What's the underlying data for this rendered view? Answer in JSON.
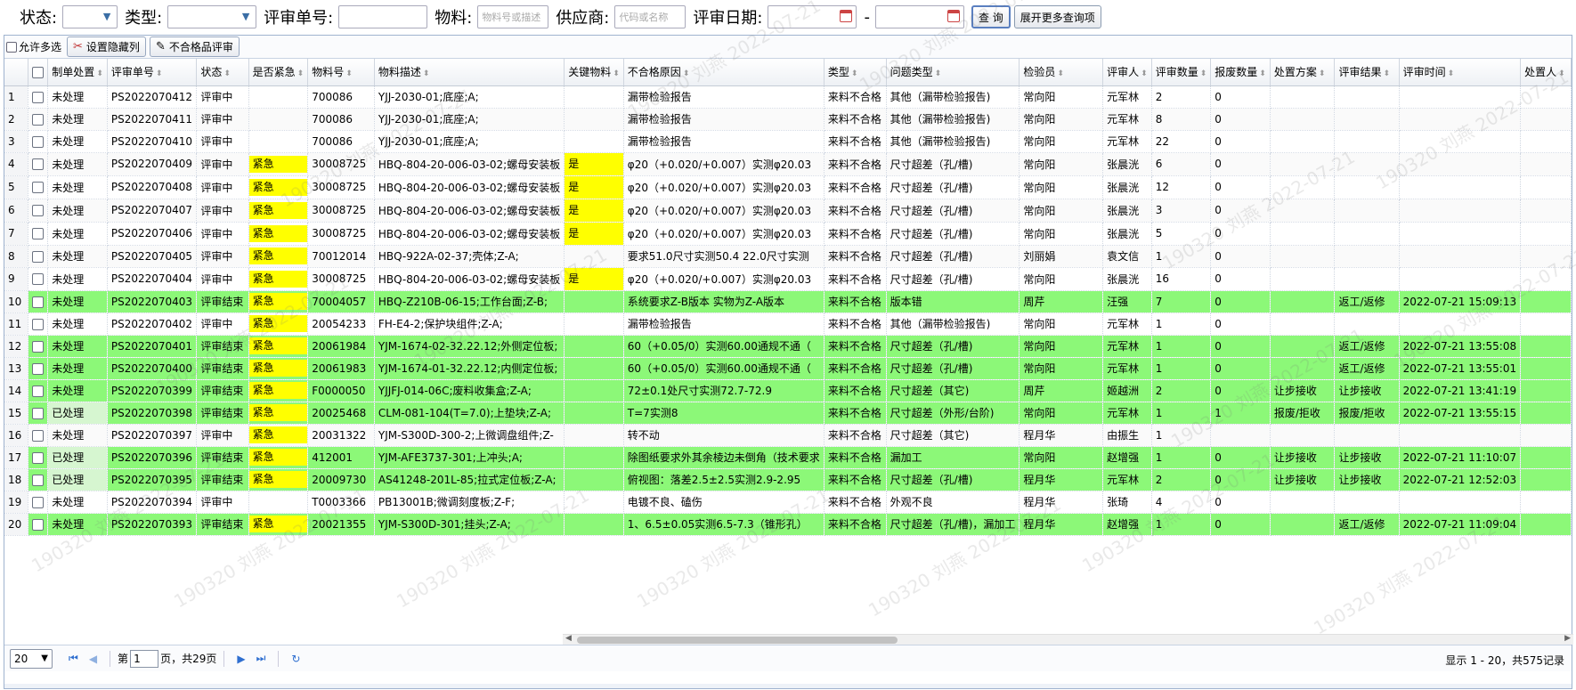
{
  "query": {
    "status_label": "状态:",
    "type_label": "类型:",
    "review_no_label": "评审单号:",
    "material_label": "物料:",
    "material_placeholder": "物料号或描述",
    "supplier_label": "供应商:",
    "supplier_placeholder": "代码或名称",
    "review_date_label": "评审日期:",
    "date_sep": "-",
    "query_btn": "查 询",
    "more_btn": "展开更多查询项"
  },
  "toolbar": {
    "multi_select": "允许多选",
    "hide_cols": "设置隐藏列",
    "nonconform_review": "不合格品评审"
  },
  "columns": [
    "制单处置",
    "评审单号",
    "状态",
    "是否紧急",
    "物料号",
    "物料描述",
    "关键物料",
    "不合格原因",
    "类型",
    "问题类型",
    "检验员",
    "评审人",
    "评审数量",
    "报废数量",
    "处置方案",
    "评审结果",
    "评审时间",
    "处置人"
  ],
  "rows": [
    {
      "n": "1",
      "c": [
        "未处理",
        "PS2022070412",
        "评审中",
        "",
        "700086",
        "YJJ-2030-01;底座;A;",
        "",
        "漏带检验报告",
        "来料不合格",
        "其他（漏带检验报告)",
        "常向阳",
        "元军林",
        "2",
        "0",
        "",
        "",
        ""
      ],
      "green": false
    },
    {
      "n": "2",
      "c": [
        "未处理",
        "PS2022070411",
        "评审中",
        "",
        "700086",
        "YJJ-2030-01;底座;A;",
        "",
        "漏带检验报告",
        "来料不合格",
        "其他（漏带检验报告)",
        "常向阳",
        "元军林",
        "8",
        "0",
        "",
        "",
        ""
      ],
      "green": false
    },
    {
      "n": "3",
      "c": [
        "未处理",
        "PS2022070410",
        "评审中",
        "",
        "700086",
        "YJJ-2030-01;底座;A;",
        "",
        "漏带检验报告",
        "来料不合格",
        "其他（漏带检验报告)",
        "常向阳",
        "元军林",
        "22",
        "0",
        "",
        "",
        ""
      ],
      "green": false
    },
    {
      "n": "4",
      "c": [
        "未处理",
        "PS2022070409",
        "评审中",
        "紧急",
        "30008725",
        "HBQ-804-20-006-03-02;螺母安装板",
        "是",
        "φ20（+0.020/+0.007）实测φ20.03",
        "来料不合格",
        "尺寸超差（孔/槽)",
        "常向阳",
        "张晨洸",
        "6",
        "0",
        "",
        "",
        ""
      ],
      "green": false
    },
    {
      "n": "5",
      "c": [
        "未处理",
        "PS2022070408",
        "评审中",
        "紧急",
        "30008725",
        "HBQ-804-20-006-03-02;螺母安装板",
        "是",
        "φ20（+0.020/+0.007）实测φ20.03",
        "来料不合格",
        "尺寸超差（孔/槽)",
        "常向阳",
        "张晨洸",
        "12",
        "0",
        "",
        "",
        ""
      ],
      "green": false
    },
    {
      "n": "6",
      "c": [
        "未处理",
        "PS2022070407",
        "评审中",
        "紧急",
        "30008725",
        "HBQ-804-20-006-03-02;螺母安装板",
        "是",
        "φ20（+0.020/+0.007）实测φ20.03",
        "来料不合格",
        "尺寸超差（孔/槽)",
        "常向阳",
        "张晨洸",
        "3",
        "0",
        "",
        "",
        ""
      ],
      "green": false
    },
    {
      "n": "7",
      "c": [
        "未处理",
        "PS2022070406",
        "评审中",
        "紧急",
        "30008725",
        "HBQ-804-20-006-03-02;螺母安装板",
        "是",
        "φ20（+0.020/+0.007）实测φ20.03",
        "来料不合格",
        "尺寸超差（孔/槽)",
        "常向阳",
        "张晨洸",
        "5",
        "0",
        "",
        "",
        ""
      ],
      "green": false
    },
    {
      "n": "8",
      "c": [
        "未处理",
        "PS2022070405",
        "评审中",
        "紧急",
        "70012014",
        "HBQ-922A-02-37;壳体;Z-A;",
        "",
        "要求51.0尺寸实测50.4 22.0尺寸实测",
        "来料不合格",
        "尺寸超差（孔/槽)",
        "刘丽娟",
        "袁文信",
        "1",
        "0",
        "",
        "",
        ""
      ],
      "green": false
    },
    {
      "n": "9",
      "c": [
        "未处理",
        "PS2022070404",
        "评审中",
        "紧急",
        "30008725",
        "HBQ-804-20-006-03-02;螺母安装板",
        "是",
        "φ20（+0.020/+0.007）实测φ20.03",
        "来料不合格",
        "尺寸超差（孔/槽)",
        "常向阳",
        "张晨洸",
        "16",
        "0",
        "",
        "",
        ""
      ],
      "green": false
    },
    {
      "n": "10",
      "c": [
        "未处理",
        "PS2022070403",
        "评审结束",
        "紧急",
        "70004057",
        "HBQ-Z210B-06-15;工作台面;Z-B;",
        "",
        "系统要求Z-B版本 实物为Z-A版本",
        "来料不合格",
        "版本错",
        "周芹",
        "汪强",
        "7",
        "0",
        "",
        "返工/返修",
        "2022-07-21 15:09:13"
      ],
      "green": true
    },
    {
      "n": "11",
      "c": [
        "未处理",
        "PS2022070402",
        "评审中",
        "紧急",
        "20054233",
        "FH-E4-2;保护块组件;Z-A;",
        "",
        "漏带检验报告",
        "来料不合格",
        "其他（漏带检验报告)",
        "常向阳",
        "元军林",
        "1",
        "0",
        "",
        "",
        ""
      ],
      "green": false
    },
    {
      "n": "12",
      "c": [
        "未处理",
        "PS2022070401",
        "评审结束",
        "紧急",
        "20061984",
        "YJM-1674-02-32.22.12;外侧定位板;",
        "",
        "60（+0.05/0）实测60.00通规不通（",
        "来料不合格",
        "尺寸超差（孔/槽)",
        "常向阳",
        "元军林",
        "1",
        "0",
        "",
        "返工/返修",
        "2022-07-21 13:55:08"
      ],
      "green": true
    },
    {
      "n": "13",
      "c": [
        "未处理",
        "PS2022070400",
        "评审结束",
        "紧急",
        "20061983",
        "YJM-1674-01-32.22.12;内侧定位板;",
        "",
        "60（+0.05/0）实测60.00通规不通（",
        "来料不合格",
        "尺寸超差（孔/槽)",
        "常向阳",
        "元军林",
        "1",
        "0",
        "",
        "返工/返修",
        "2022-07-21 13:55:01"
      ],
      "green": true
    },
    {
      "n": "14",
      "c": [
        "未处理",
        "PS2022070399",
        "评审结束",
        "紧急",
        "F0000050",
        "YJJFJ-014-06C;废料收集盒;Z-A;",
        "",
        "72±0.1处尺寸实测72.7-72.9",
        "来料不合格",
        "尺寸超差（其它)",
        "周芹",
        "姬越洲",
        "2",
        "0",
        "让步接收",
        "让步接收",
        "2022-07-21 13:41:19"
      ],
      "green": true
    },
    {
      "n": "15",
      "c": [
        "已处理",
        "PS2022070398",
        "评审结束",
        "紧急",
        "20025468",
        "CLM-081-104(T=7.0);上垫块;Z-A;",
        "",
        "T=7实测8",
        "来料不合格",
        "尺寸超差（外形/台阶)",
        "常向阳",
        "元军林",
        "1",
        "1",
        "报废/拒收",
        "报废/拒收",
        "2022-07-21 13:55:15"
      ],
      "green": true
    },
    {
      "n": "16",
      "c": [
        "未处理",
        "PS2022070397",
        "评审中",
        "紧急",
        "20031322",
        "YJM-S300D-300-2;上微调盘组件;Z-",
        "",
        "转不动",
        "来料不合格",
        "尺寸超差（其它)",
        "程月华",
        "由振生",
        "1",
        "",
        "",
        "",
        ""
      ],
      "green": false
    },
    {
      "n": "17",
      "c": [
        "已处理",
        "PS2022070396",
        "评审结束",
        "紧急",
        "412001",
        "YJM-AFE3737-301;上冲头;A;",
        "",
        "除图纸要求外其余棱边未倒角（技术要求",
        "来料不合格",
        "漏加工",
        "常向阳",
        "赵增强",
        "1",
        "0",
        "让步接收",
        "让步接收",
        "2022-07-21 11:10:07"
      ],
      "green": true
    },
    {
      "n": "18",
      "c": [
        "已处理",
        "PS2022070395",
        "评审结束",
        "紧急",
        "20009730",
        "AS41248-201L-85;拉式定位板;Z-A;",
        "",
        "俯视图：落差2.5±2.5实测2.9-2.95",
        "来料不合格",
        "尺寸超差（孔/槽)",
        "程月华",
        "元军林",
        "2",
        "0",
        "让步接收",
        "让步接收",
        "2022-07-21 12:52:03"
      ],
      "green": true
    },
    {
      "n": "19",
      "c": [
        "未处理",
        "PS2022070394",
        "评审中",
        "",
        "T0003366",
        "PB13001B;微调刻度板;Z-F;",
        "",
        "电镀不良、磕伤",
        "来料不合格",
        "外观不良",
        "程月华",
        "张琦",
        "4",
        "0",
        "",
        "",
        ""
      ],
      "green": false
    },
    {
      "n": "20",
      "c": [
        "未处理",
        "PS2022070393",
        "评审结束",
        "紧急",
        "20021355",
        "YJM-S300D-301;挂头;Z-A;",
        "",
        "1、6.5±0.05实测6.5-7.3（锥形孔）",
        "来料不合格",
        "尺寸超差（孔/槽)，漏加工",
        "程月华",
        "赵增强",
        "1",
        "0",
        "",
        "返工/返修",
        "2022-07-21 11:09:04"
      ],
      "green": true
    }
  ],
  "pager": {
    "page_size": "20",
    "page_prefix": "第",
    "page_value": "1",
    "page_suffix": "页，共29页",
    "info": "显示 1 - 20，共575记录"
  },
  "watermark": "190320 刘燕 2022-07-21"
}
